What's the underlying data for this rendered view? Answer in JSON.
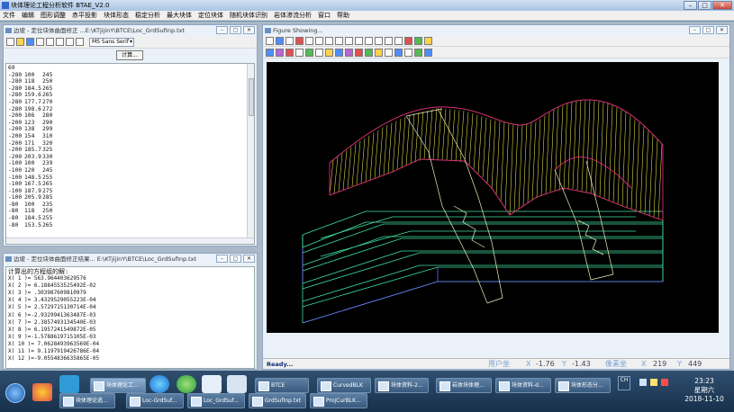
{
  "app": {
    "title": "块体理论工程分析软件 BTAE_V2.0"
  },
  "menu": [
    "文件",
    "编辑",
    "图形调整",
    "赤平投影",
    "块体形态",
    "稳定分析",
    "最大块体",
    "定位块体",
    "随机块体识别",
    "岩体渗流分析",
    "窗口",
    "帮助"
  ],
  "editor_window": {
    "title": "边坡 - 定位块体曲面修正 ...E:\\KTjijinY\\BTCE\\Loc_GrdSufInp.txt",
    "font_select": "MS Sans Serif",
    "calc_button": "计算...",
    "lines": [
      [
        "69",
        "",
        ""
      ],
      [
        "-280",
        "100",
        "245"
      ],
      [
        "-280",
        "118",
        "250"
      ],
      [
        "-280",
        "184.5",
        "265"
      ],
      [
        "-280",
        "159.6",
        "265"
      ],
      [
        "-280",
        "177.7",
        "270"
      ],
      [
        "-280",
        "198.6",
        "272"
      ],
      [
        "-200",
        "106",
        "280"
      ],
      [
        "-200",
        "123",
        "290"
      ],
      [
        "-200",
        "138",
        "299"
      ],
      [
        "-200",
        "154",
        "310"
      ],
      [
        "-200",
        "171",
        "320"
      ],
      [
        "-200",
        "185.7",
        "325"
      ],
      [
        "-200",
        "203.9",
        "330"
      ],
      [
        "-100",
        "100",
        "239"
      ],
      [
        "-100",
        "120",
        "245"
      ],
      [
        "-100",
        "148.5",
        "255"
      ],
      [
        "-100",
        "167.5",
        "265"
      ],
      [
        "-100",
        "187.9",
        "275"
      ],
      [
        "-100",
        "205.9",
        "285"
      ],
      [
        "-80",
        "100",
        "235"
      ],
      [
        "-80",
        "118",
        "250"
      ],
      [
        "-80",
        "184.5",
        "255"
      ],
      [
        "-80",
        "153.5",
        "265"
      ]
    ]
  },
  "results_window": {
    "title": "边坡 - 定位块体曲面修正结果... E:\\KTjijinY\\BTCE\\Loc_GrdSufInp.txt",
    "heading": "计算出的方程组的解:",
    "lines": [
      "X( 1 )= 563.964403629576",
      "X( 2 )= 6.1884553525492E-02",
      "X( 3 )= .303987609810979",
      "X( 4 )= 3.4329529055223E-04",
      "X( 5 )= 2.5729715130714E-04",
      "X( 6 )=-2.9329941363487E-03",
      "X( 7 )= 2.3857493134540E-03",
      "X( 8 )= 6.1957241549872E-05",
      "X( 9 )=-1.5788619715105E-03",
      "X( 10 )= 7.0628493963569E-04",
      "X( 11 )= 9.1197919426786E-04",
      "X( 12 )=-9.0554836635865E-05"
    ]
  },
  "figure_window": {
    "title": "Figure Showing...",
    "status": {
      "ready": "Ready...",
      "user_coord_label": "用户坐",
      "x_label": "X",
      "x_value": "-1.76",
      "y_label": "Y",
      "y_value": "-1.43",
      "pixel_coord_label": "像素坐",
      "px_label": "X",
      "px_value": "219",
      "py_label": "Y",
      "py_value": "449"
    }
  },
  "taskbar": {
    "row1": [
      "块体理论工...",
      "",
      "",
      "",
      "",
      "BTCE",
      "CurvedBLK",
      "块体资料-2...",
      "岩体块体理...",
      "块体资料-d...",
      "块体形态分..."
    ],
    "row2": [
      "块体理论逃...",
      "Loc-GrdSuf...",
      "Loc_GrdSuf...",
      "GrdSufInp.txt",
      "ProjCurBLK..."
    ],
    "lang": "CH",
    "time": "23:23",
    "weekday": "星期六",
    "date": "2018-11-10"
  }
}
